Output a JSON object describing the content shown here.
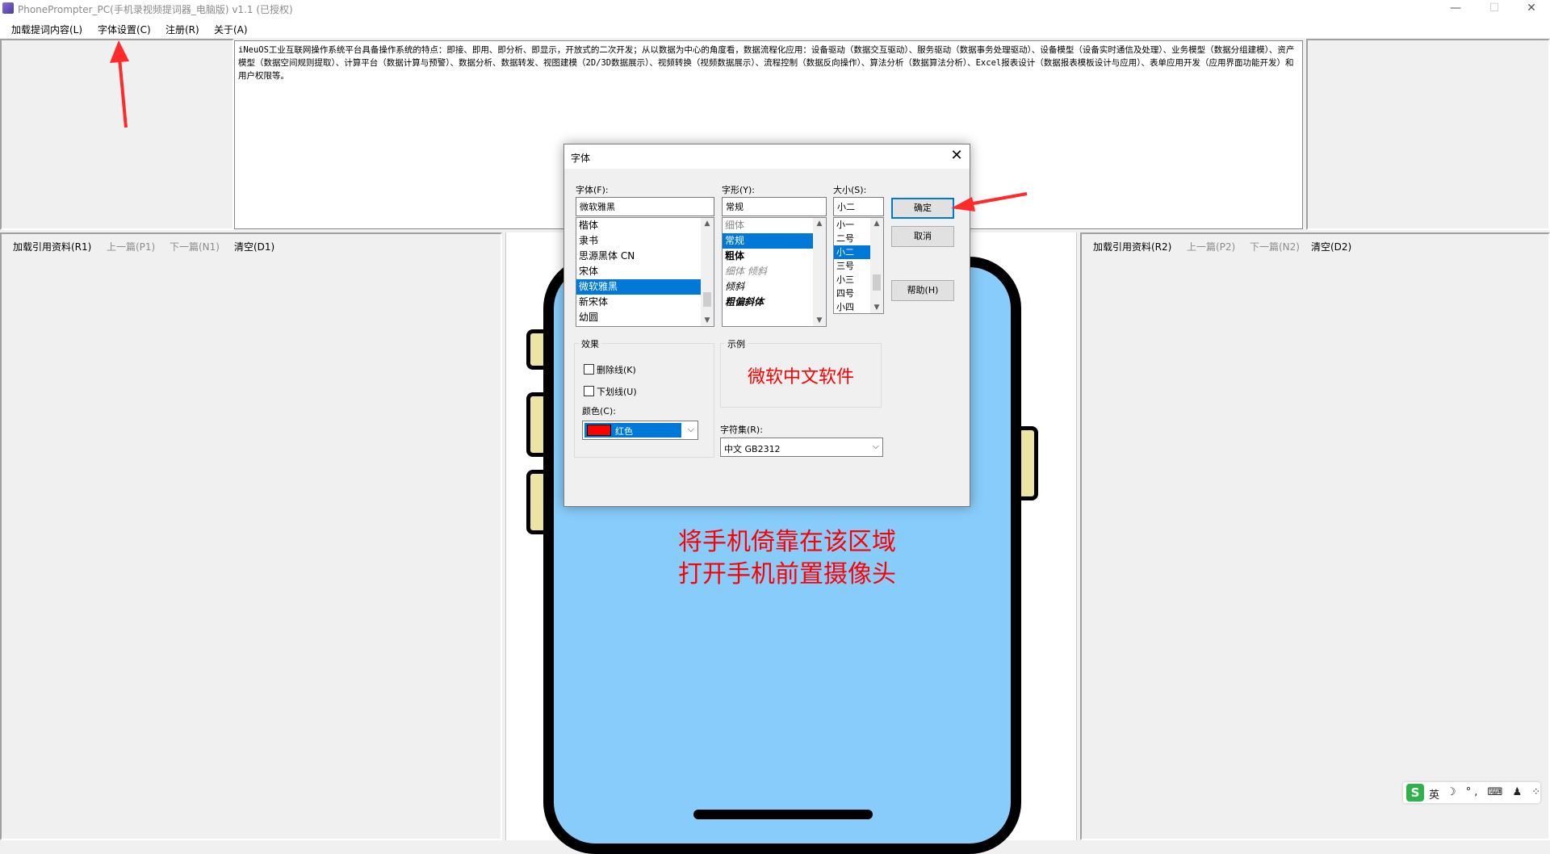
{
  "window": {
    "title": "PhonePrompter_PC(手机录视频提词器_电脑版) v1.1 (已授权)",
    "minimize_glyph": "—",
    "maximize_glyph": "☐",
    "close_glyph": "✕"
  },
  "menu": {
    "items": [
      "加载提词内容(L)",
      "字体设置(C)",
      "注册(R)",
      "关于(A)"
    ]
  },
  "prompt_text": "iNeuOS工业互联网操作系统平台具备操作系统的特点：即接、即用、即分析、即显示，开放式的二次开发；从以数据为中心的角度看，数据流程化应用：设备驱动（数据交互驱动）、服务驱动（数据事务处理驱动）、设备模型（设备实时通信及处理）、业务模型（数据分组建模）、资产模型（数据空间规则提取）、计算平台（数据计算与预警）、数据分析、数据转发、视图建模（2D/3D数据展示）、视频转换（视频数据展示）、流程控制（数据反向操作）、算法分析（数据算法分析）、Excel报表设计（数据报表模板设计与应用）、表单应用开发（应用界面功能开发）和用户权限等。",
  "left_toolbar": [
    "加载引用资料(R1)",
    "上一篇(P1)",
    "下一篇(N1)",
    "清空(D1)"
  ],
  "right_toolbar": [
    "加载引用资料(R2)",
    "上一篇(P2)",
    "下一篇(N2)",
    "清空(D2)"
  ],
  "phone_hint": [
    "将手机倚靠在该区域",
    "打开手机前置摄像头"
  ],
  "font_dialog": {
    "title": "字体",
    "font_label": "字体(F):",
    "font_value": "微软雅黑",
    "font_list": [
      "楷体",
      "隶书",
      "思源黑体 CN",
      "宋体",
      "微软雅黑",
      "新宋体",
      "幼圆"
    ],
    "font_selected_index": 4,
    "style_label": "字形(Y):",
    "style_value": "常规",
    "style_list": [
      "细体",
      "常规",
      "粗体",
      "细体 倾斜",
      "倾斜",
      "粗偏斜体"
    ],
    "style_selected_index": 1,
    "size_label": "大小(S):",
    "size_value": "小二",
    "size_list": [
      "小一",
      "二号",
      "小二",
      "三号",
      "小三",
      "四号",
      "小四"
    ],
    "size_selected_index": 2,
    "ok": "确定",
    "cancel": "取消",
    "help": "帮助(H)",
    "effects_label": "效果",
    "strikeout": "删除线(K)",
    "underline": "下划线(U)",
    "color_label": "颜色(C):",
    "color_value": "红色",
    "color_swatch": "#ff0000",
    "sample_label": "示例",
    "sample_text": "微软中文软件",
    "charset_label": "字符集(R):",
    "charset_value": "中文 GB2312"
  },
  "ime": {
    "logo": "S",
    "lang": "英",
    "icons": "☽ °, ⌨ ♟ ⁘"
  },
  "colors": {
    "phone_screen": "#88ccfb",
    "hint_text": "#ff0000",
    "selection": "#0078d7",
    "annotation_arrow": "#ff2a2a"
  }
}
